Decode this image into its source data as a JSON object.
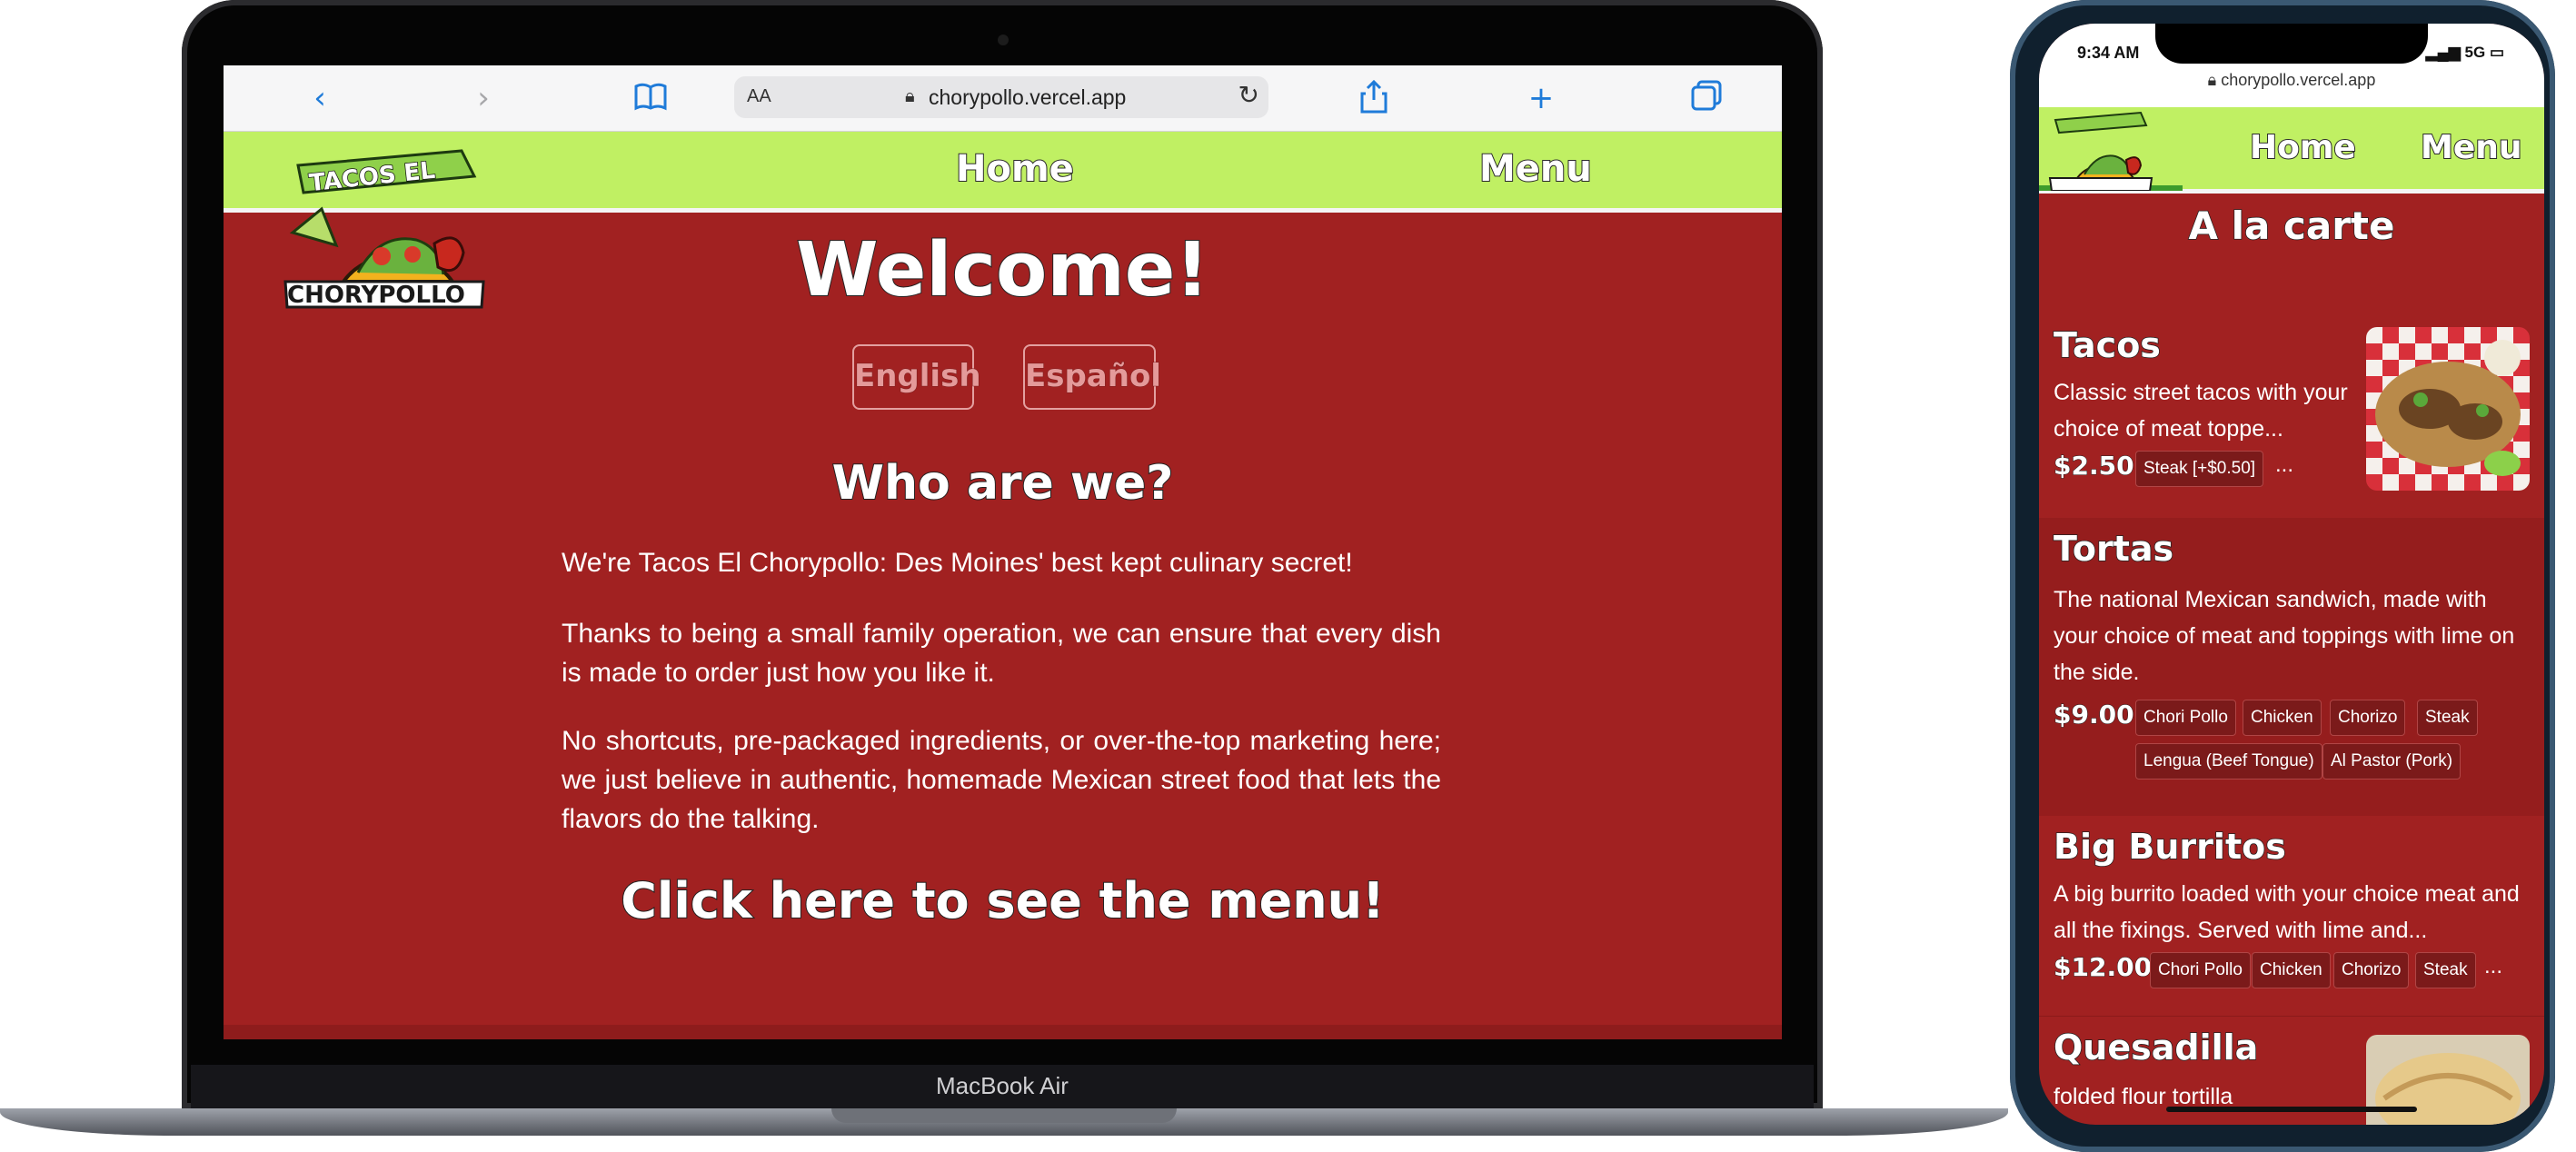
{
  "laptop": {
    "brand": "MacBook Air",
    "browser": {
      "text_size_label": "AA",
      "url": "chorypollo.vercel.app"
    },
    "nav": {
      "home": "Home",
      "menu": "Menu"
    },
    "logo": {
      "line1": "TACOS EL",
      "line2": "CHORYPOLLO"
    },
    "page": {
      "title": "Welcome!",
      "lang_en": "English",
      "lang_es": "Español",
      "heading": "Who are we?",
      "paragraphs": [
        "We're Tacos El Chorypollo: Des Moines' best kept culinary secret!",
        "Thanks to being a small family operation, we can ensure that every dish is made to order just how you like it.",
        "No shortcuts, pre-packaged ingredients, or over-the-top marketing here; we just believe in authentic, homemade Mexican street food that lets the flavors do the talking."
      ],
      "cta": "Click here to see the menu!"
    }
  },
  "phone": {
    "time": "9:34 AM",
    "signal": "5G",
    "url": "chorypollo.vercel.app",
    "nav": {
      "home": "Home",
      "menu": "Menu"
    },
    "page_title": "A la carte",
    "items": [
      {
        "name": "Tacos",
        "desc": "Classic street tacos with your choice of meat toppe...",
        "price": "$2.50",
        "chips": [
          "Steak [+$0.50]"
        ],
        "more": "..."
      },
      {
        "name": "Tortas",
        "desc": "The national Mexican sandwich, made with your choice of meat and toppings with lime on the side.",
        "price": "$9.00",
        "chips": [
          "Chori Pollo",
          "Chicken",
          "Chorizo",
          "Steak",
          "Lengua (Beef Tongue)",
          "Al Pastor (Pork)"
        ]
      },
      {
        "name": "Big Burritos",
        "desc": "A big burrito loaded with your choice meat and all the fixings. Served with lime and...",
        "price": "$12.00",
        "chips": [
          "Chori Pollo",
          "Chicken",
          "Chorizo",
          "Steak"
        ],
        "more": "..."
      },
      {
        "name": "Quesadilla",
        "desc": "folded flour tortilla"
      }
    ]
  }
}
